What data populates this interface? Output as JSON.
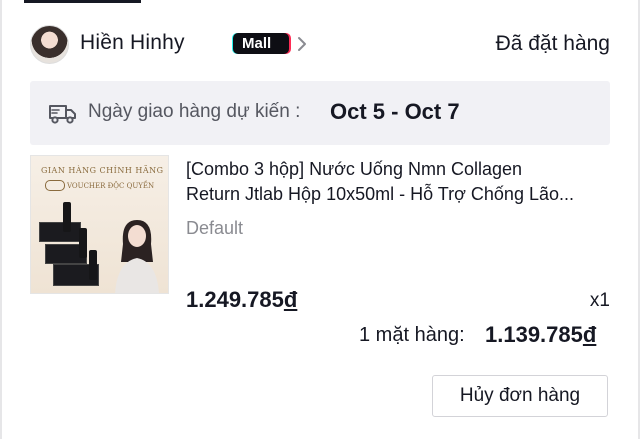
{
  "shop": {
    "name": "Hiền Hinhy",
    "badge": "Mall",
    "order_status": "Đã đặt hàng",
    "avatar_icon": "user-avatar",
    "chevron_icon": "chevron-right-icon"
  },
  "delivery": {
    "icon": "truck-icon",
    "label": "Ngày giao hàng dự kiến : ",
    "dates": "Oct 5 - Oct 7"
  },
  "product": {
    "image_banner": "GIAN HÀNG CHÍNH HÃNG",
    "image_voucher": "VOUCHER ĐỘC QUYỀN",
    "title_line1": "[Combo 3 hộp] Nước Uống Nmn Collagen",
    "title_line2": "Return Jtlab Hộp 10x50ml - Hỗ Trợ Chống Lão...",
    "variant": "Default",
    "price": "1.249.785",
    "currency": "đ",
    "quantity": "x1"
  },
  "summary": {
    "label": "1 mặt hàng: ",
    "total": "1.139.785",
    "currency": "đ"
  },
  "actions": {
    "cancel_label": "Hủy đơn hàng"
  },
  "colors": {
    "accent_pink": "#fe2c55",
    "accent_cyan": "#25f4ee",
    "text": "#161823",
    "muted": "#8a8b91",
    "delivery_bg": "#f1f1f5"
  }
}
